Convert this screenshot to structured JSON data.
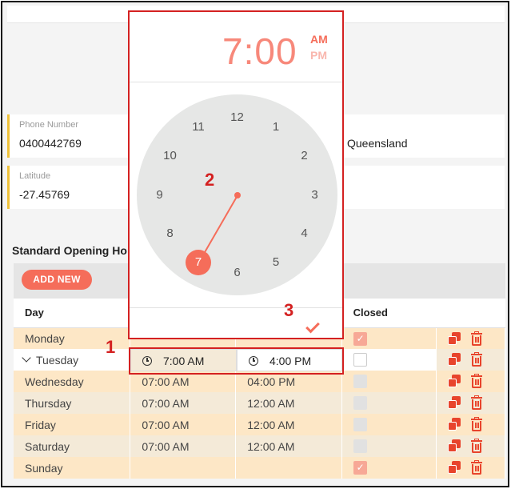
{
  "cards": {
    "phone": {
      "label": "Phone Number",
      "value": "0400442769"
    },
    "state": {
      "value": "Queensland"
    },
    "latitude": {
      "label": "Latitude",
      "value": "-27.45769"
    }
  },
  "hours_section": {
    "title": "Standard Opening Ho",
    "add_label": "ADD NEW",
    "columns": [
      "Day",
      "",
      "",
      "Closed",
      ""
    ],
    "rows": [
      {
        "day": "Monday",
        "open": "",
        "close": "",
        "closed": true
      },
      {
        "day": "Tuesday",
        "open": "7:00 AM",
        "close": "4:00 PM",
        "closed": false
      },
      {
        "day": "Wednesday",
        "open": "07:00 AM",
        "close": "04:00 PM",
        "closed": false
      },
      {
        "day": "Thursday",
        "open": "07:00 AM",
        "close": "12:00 AM",
        "closed": false
      },
      {
        "day": "Friday",
        "open": "07:00 AM",
        "close": "12:00 AM",
        "closed": false
      },
      {
        "day": "Saturday",
        "open": "07:00 AM",
        "close": "12:00 AM",
        "closed": false
      },
      {
        "day": "Sunday",
        "open": "",
        "close": "",
        "closed": true
      }
    ]
  },
  "time_picker": {
    "time": "7:00",
    "am": "AM",
    "pm": "PM",
    "selected_period": "AM",
    "selected_hour": 7,
    "dial_numbers": [
      "12",
      "1",
      "2",
      "3",
      "4",
      "5",
      "6",
      "7",
      "8",
      "9",
      "10",
      "11"
    ]
  },
  "annotations": {
    "step1": "1",
    "step2": "2",
    "step3": "3"
  },
  "colors": {
    "accent": "#f56d5a",
    "highlight": "#d42121",
    "row_odd": "#fde7c6",
    "row_even": "#f4ead8"
  },
  "icons": [
    "copy-icon",
    "trash-icon",
    "clock-icon",
    "chevron-down-icon",
    "check-icon"
  ]
}
